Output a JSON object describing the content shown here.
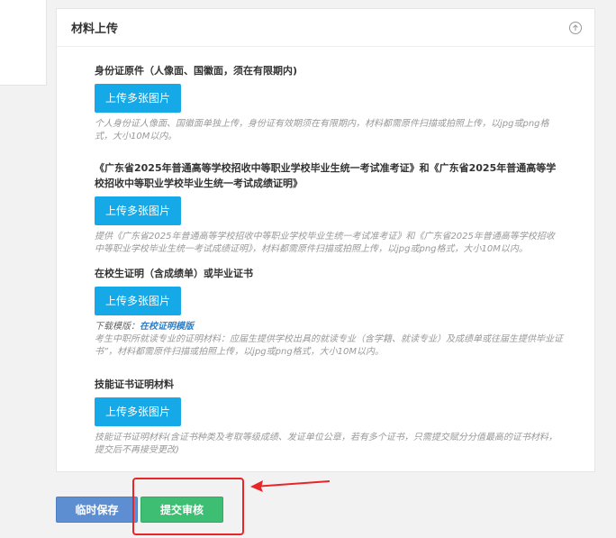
{
  "card": {
    "title": "材料上传"
  },
  "sections": [
    {
      "label": "身份证原件（人像面、国徽面，须在有限期内)",
      "button": "上传多张图片",
      "hint": "个人身份证人像面、国徽面单独上传，身份证有效期须在有限期内，材料都需原件扫描或拍照上传，以jpg或png格式，大小10M以内。"
    },
    {
      "label": "《广东省2025年普通高等学校招收中等职业学校毕业生统一考试准考证》和《广东省2025年普通高等学校招收中等职业学校毕业生统一考试成绩证明》",
      "button": "上传多张图片",
      "hint": "提供《广东省2025年普通高等学校招收中等职业学校毕业生统一考试准考证》和《广东省2025年普通高等学校招收中等职业学校毕业生统一考试成绩证明》，材料都需原件扫描或拍照上传，以jpg或png格式，大小10M以内。"
    },
    {
      "label": "在校生证明（含成绩单）或毕业证书",
      "button": "上传多张图片",
      "download_label": "下载模版：",
      "download_link": "在校证明模版",
      "hint": "考生中职所就读专业的证明材料：应届生提供学校出具的就读专业（含学籍、就读专业）及成绩单或往届生提供毕业证书”，材料都需原件扫描或拍照上传，以jpg或png格式，大小10M以内。"
    },
    {
      "label": "技能证书证明材料",
      "button": "上传多张图片",
      "hint": "技能证书证明材料(含证书种类及考取等级成绩、发证单位公章，若有多个证书，只需提交赋分分值最高的证书材料，提交后不再接受更改)"
    }
  ],
  "actions": {
    "save_label": "临时保存",
    "submit_label": "提交审核"
  },
  "colors": {
    "upload_button": "#16a9e8",
    "save_button": "#5d8ed1",
    "submit_button": "#3ebe73",
    "highlight": "#e8262a"
  }
}
